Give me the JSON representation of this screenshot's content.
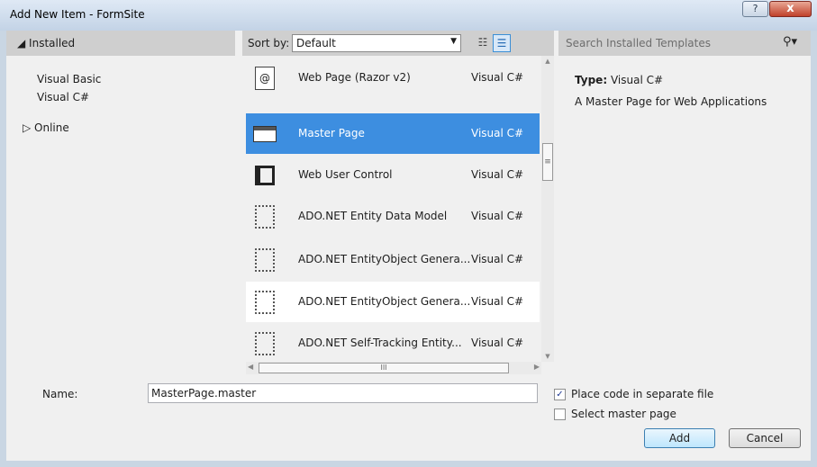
{
  "window": {
    "title": "Add New Item - FormSite",
    "help_glyph": "?",
    "close_glyph": "x"
  },
  "left": {
    "installed_header": "◢ Installed",
    "items": [
      "Visual Basic",
      "Visual C#"
    ],
    "online": "▷ Online"
  },
  "toolbar": {
    "sort_label": "Sort by:",
    "sort_value": "Default",
    "dropdown_glyph": "▼",
    "view_medium_glyph": "☷",
    "view_list_glyph": "☰"
  },
  "templates": [
    {
      "name": "Web Page (Razor v2)",
      "language": "Visual C#",
      "icon": "web-page-icon",
      "icon_glyph": "@"
    },
    {
      "name": "Master Page",
      "language": "Visual C#",
      "icon": "master-page-icon",
      "selected": true
    },
    {
      "name": "Web User Control",
      "language": "Visual C#",
      "icon": "user-control-icon"
    },
    {
      "name": "ADO.NET Entity Data Model",
      "language": "Visual C#",
      "icon": "file-icon"
    },
    {
      "name": "ADO.NET EntityObject Genera...",
      "language": "Visual C#",
      "icon": "file-icon"
    },
    {
      "name": "ADO.NET EntityObject Genera...",
      "language": "Visual C#",
      "icon": "file-icon"
    },
    {
      "name": "ADO.NET Self-Tracking Entity...",
      "language": "Visual C#",
      "icon": "file-icon"
    }
  ],
  "scroll": {
    "v_up": "▲",
    "v_thumb": "≡",
    "v_down": "▼",
    "h_left": "◀",
    "h_thumb": "III",
    "h_right": "▶"
  },
  "details": {
    "search_placeholder": "Search Installed Templates",
    "search_glyph": "⚲▾",
    "type_label": "Type:",
    "type_value": "Visual C#",
    "description": "A Master Page for Web Applications"
  },
  "form": {
    "name_label": "Name:",
    "name_value": "MasterPage.master",
    "check_glyph": "✓",
    "place_code_label": "Place code in separate file",
    "place_code_checked": true,
    "select_master_label": "Select master page",
    "select_master_checked": false,
    "add_label": "Add",
    "cancel_label": "Cancel"
  },
  "colors": {
    "selection": "#3d8ee0",
    "header_gray": "#cfcfcf",
    "panel": "#f0f0f0"
  }
}
